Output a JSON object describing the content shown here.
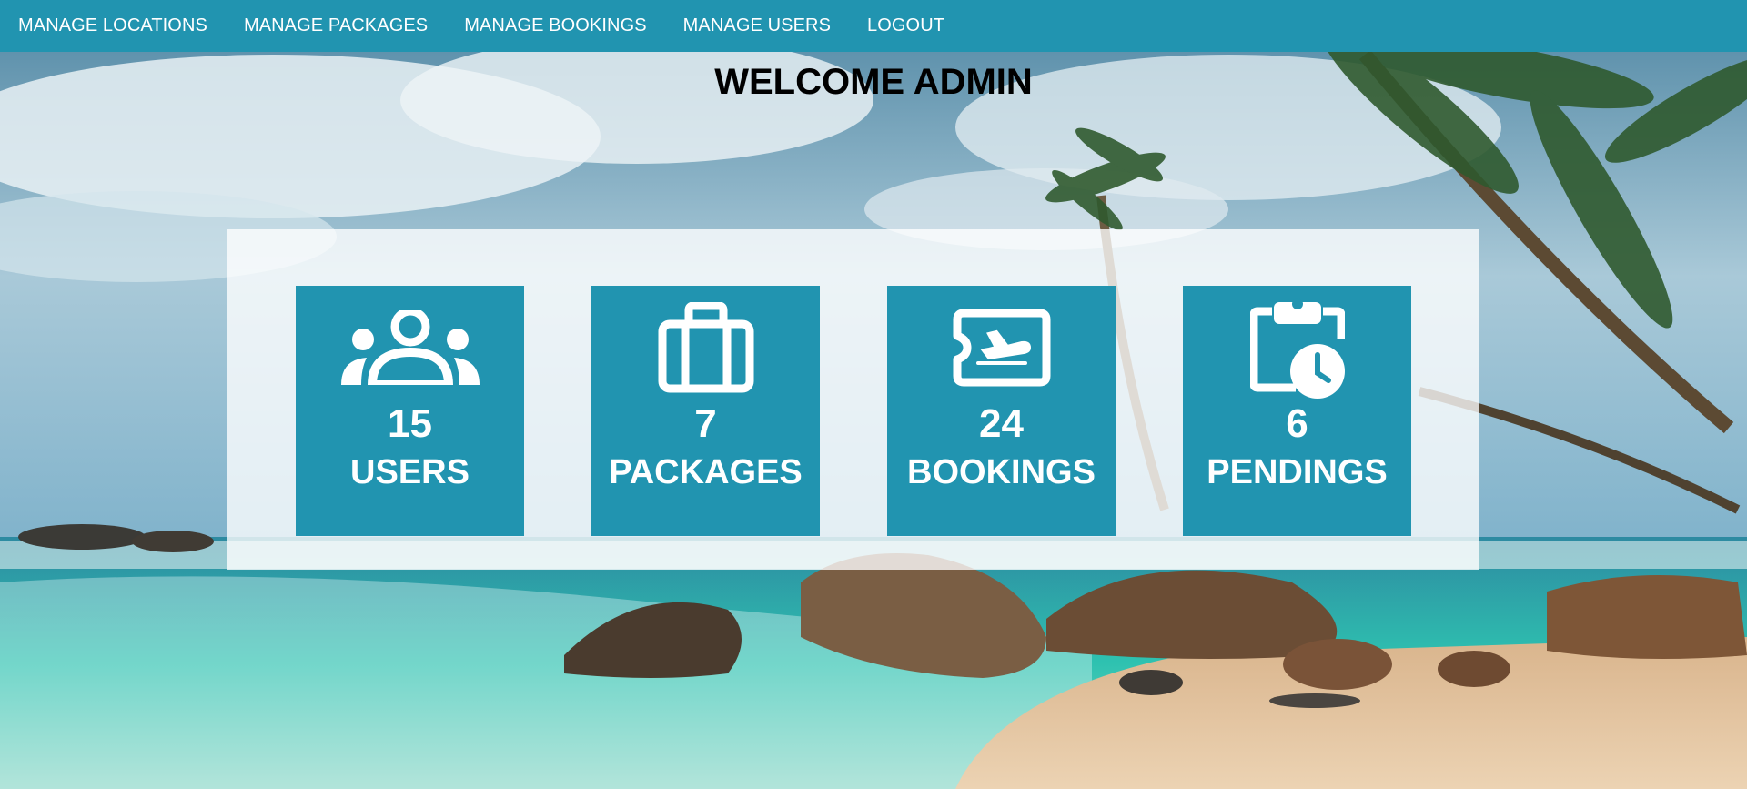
{
  "nav": {
    "items": [
      {
        "label": "MANAGE LOCATIONS"
      },
      {
        "label": "MANAGE PACKAGES"
      },
      {
        "label": "MANAGE BOOKINGS"
      },
      {
        "label": "MANAGE USERS"
      },
      {
        "label": "LOGOUT"
      }
    ]
  },
  "heading": "WELCOME ADMIN",
  "cards": [
    {
      "icon": "users-icon",
      "count": "15",
      "label": "USERS"
    },
    {
      "icon": "suitcase-icon",
      "count": "7",
      "label": "PACKAGES"
    },
    {
      "icon": "flight-ticket-icon",
      "count": "24",
      "label": "BOOKINGS"
    },
    {
      "icon": "clipboard-clock-icon",
      "count": "6",
      "label": "PENDINGS"
    }
  ],
  "colors": {
    "accent": "#2194b0",
    "text_on_accent": "#ffffff"
  }
}
